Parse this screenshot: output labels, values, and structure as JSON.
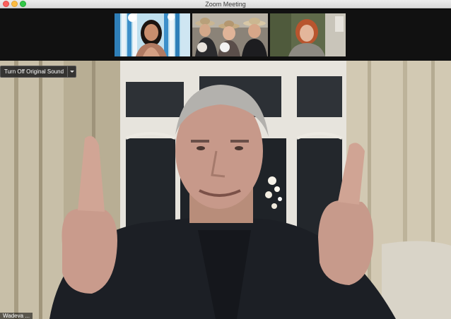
{
  "window": {
    "title": "Zoom Meeting"
  },
  "gallery": {
    "participants": [
      {
        "icon": "participant-video-1"
      },
      {
        "icon": "participant-video-2"
      },
      {
        "icon": "participant-video-3"
      }
    ]
  },
  "main": {
    "original_sound_button": "Turn Off Original Sound",
    "speaker_name": "Wadeva ..."
  },
  "colors": {
    "titlebar": "#e3e3e3",
    "gallery_bg": "#111111",
    "close": "#fc605c",
    "minimize": "#fdbc40",
    "maximize": "#34c84a"
  }
}
